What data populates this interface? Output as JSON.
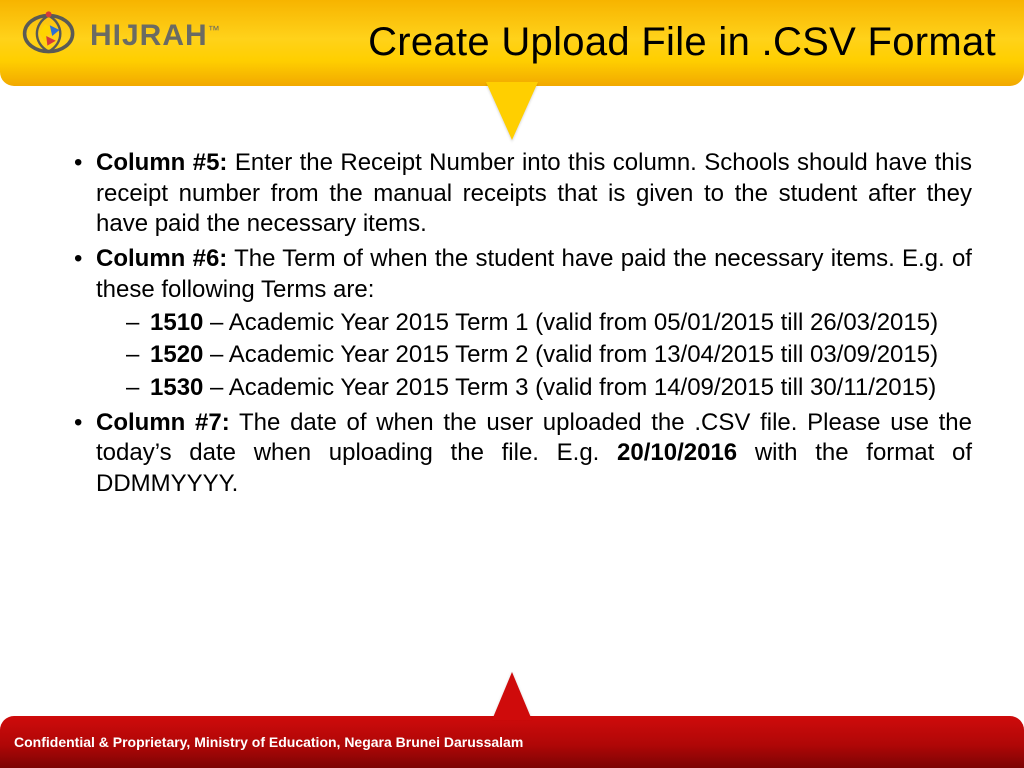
{
  "header": {
    "logo_text": "HIJRAH",
    "title": "Create Upload File in .CSV Format"
  },
  "bullets": [
    {
      "label": "Column #5:",
      "text": " Enter the Receipt Number into this column. Schools should have this receipt number from the manual receipts that is given to the student after they have paid the necessary items."
    },
    {
      "label": "Column #6:",
      "text": " The Term of when the student have paid the necessary items. E.g. of these following Terms are:",
      "sub": [
        {
          "code": "1510",
          "desc": " – Academic Year 2015 Term 1 (valid from 05/01/2015 till 26/03/2015)"
        },
        {
          "code": "1520",
          "desc": " – Academic Year 2015 Term 2 (valid from 13/04/2015 till 03/09/2015)"
        },
        {
          "code": "1530",
          "desc": " – Academic Year 2015 Term 3 (valid from 14/09/2015 till 30/11/2015)"
        }
      ]
    },
    {
      "label": "Column #7:",
      "text_pre": " The date of when the user uploaded the .CSV file. Please use the today’s date when uploading the file. E.g. ",
      "example": "20/10/2016",
      "text_post": " with the format of DDMMYYYY."
    }
  ],
  "footer": {
    "text": "Confidential & Proprietary, Ministry of Education, Negara Brunei Darussalam"
  }
}
